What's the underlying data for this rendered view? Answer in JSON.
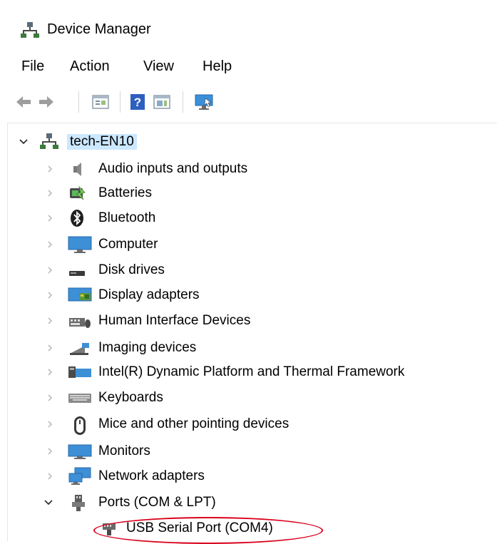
{
  "window": {
    "title": "Device Manager"
  },
  "menu": [
    "File",
    "Action",
    "View",
    "Help"
  ],
  "toolbar": {
    "buttons": [
      "back-icon",
      "forward-icon",
      "properties-icon",
      "help-icon",
      "show-hide-icon",
      "monitor-scan-icon"
    ]
  },
  "tree": {
    "root": {
      "label": "tech-EN10",
      "expanded": true
    },
    "items": [
      {
        "label": "Audio inputs and outputs",
        "icon": "speaker-icon",
        "expanded": false
      },
      {
        "label": "Batteries",
        "icon": "battery-icon",
        "expanded": false
      },
      {
        "label": "Bluetooth",
        "icon": "bluetooth-icon",
        "expanded": false
      },
      {
        "label": "Computer",
        "icon": "computer-icon",
        "expanded": false
      },
      {
        "label": "Disk drives",
        "icon": "disk-drive-icon",
        "expanded": false
      },
      {
        "label": "Display adapters",
        "icon": "display-adapter-icon",
        "expanded": false
      },
      {
        "label": "Human Interface Devices",
        "icon": "hid-icon",
        "expanded": false
      },
      {
        "label": "Imaging devices",
        "icon": "camera-icon",
        "expanded": false
      },
      {
        "label": "Intel(R) Dynamic Platform and Thermal Framework",
        "icon": "chip-icon",
        "expanded": false
      },
      {
        "label": "Keyboards",
        "icon": "keyboard-icon",
        "expanded": false
      },
      {
        "label": "Mice and other pointing devices",
        "icon": "mouse-icon",
        "expanded": false
      },
      {
        "label": "Monitors",
        "icon": "monitor-icon",
        "expanded": false
      },
      {
        "label": "Network adapters",
        "icon": "network-icon",
        "expanded": false
      },
      {
        "label": "Ports (COM & LPT)",
        "icon": "port-icon",
        "expanded": true
      }
    ],
    "child": {
      "label": "USB Serial Port (COM4)",
      "icon": "usb-port-icon"
    }
  },
  "colors": {
    "highlight": "#d9001b",
    "selection": "#cce8ff"
  }
}
